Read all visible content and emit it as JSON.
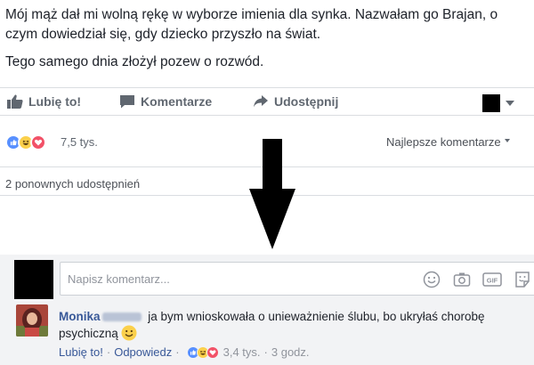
{
  "post": {
    "text_line1": "Mój mąż dał mi wolną rękę w wyborze imienia dla synka. Nazwałam go Brajan, o czym dowiedział się, gdy dziecko przyszło na świat.",
    "text_line2": "Tego samego dnia złożył pozew o rozwód."
  },
  "actions": {
    "like_label": "Lubię to!",
    "comment_label": "Komentarze",
    "share_label": "Udostępnij"
  },
  "reactions": {
    "icons": [
      "like-icon",
      "haha-icon",
      "love-icon"
    ],
    "count": "7,5 tys.",
    "sort_label": "Najlepsze komentarze"
  },
  "shares": {
    "label": "2 ponownych udostępnień"
  },
  "composer": {
    "placeholder": "Napisz komentarz..."
  },
  "comment": {
    "author": "Monika",
    "text": "ja bym wnioskowała o unieważnienie ślubu, bo ukryłaś chorobę psychiczną",
    "like_label": "Lubię to!",
    "reply_label": "Odpowiedz",
    "reaction_count": "3,4 tys.",
    "time": "3 godz."
  },
  "colors": {
    "link": "#385898",
    "muted": "#606770",
    "like_blue": "#5890ff",
    "love_red": "#f25268",
    "haha_yellow": "#fbd04b",
    "comment_bg": "#f2f3f5"
  }
}
